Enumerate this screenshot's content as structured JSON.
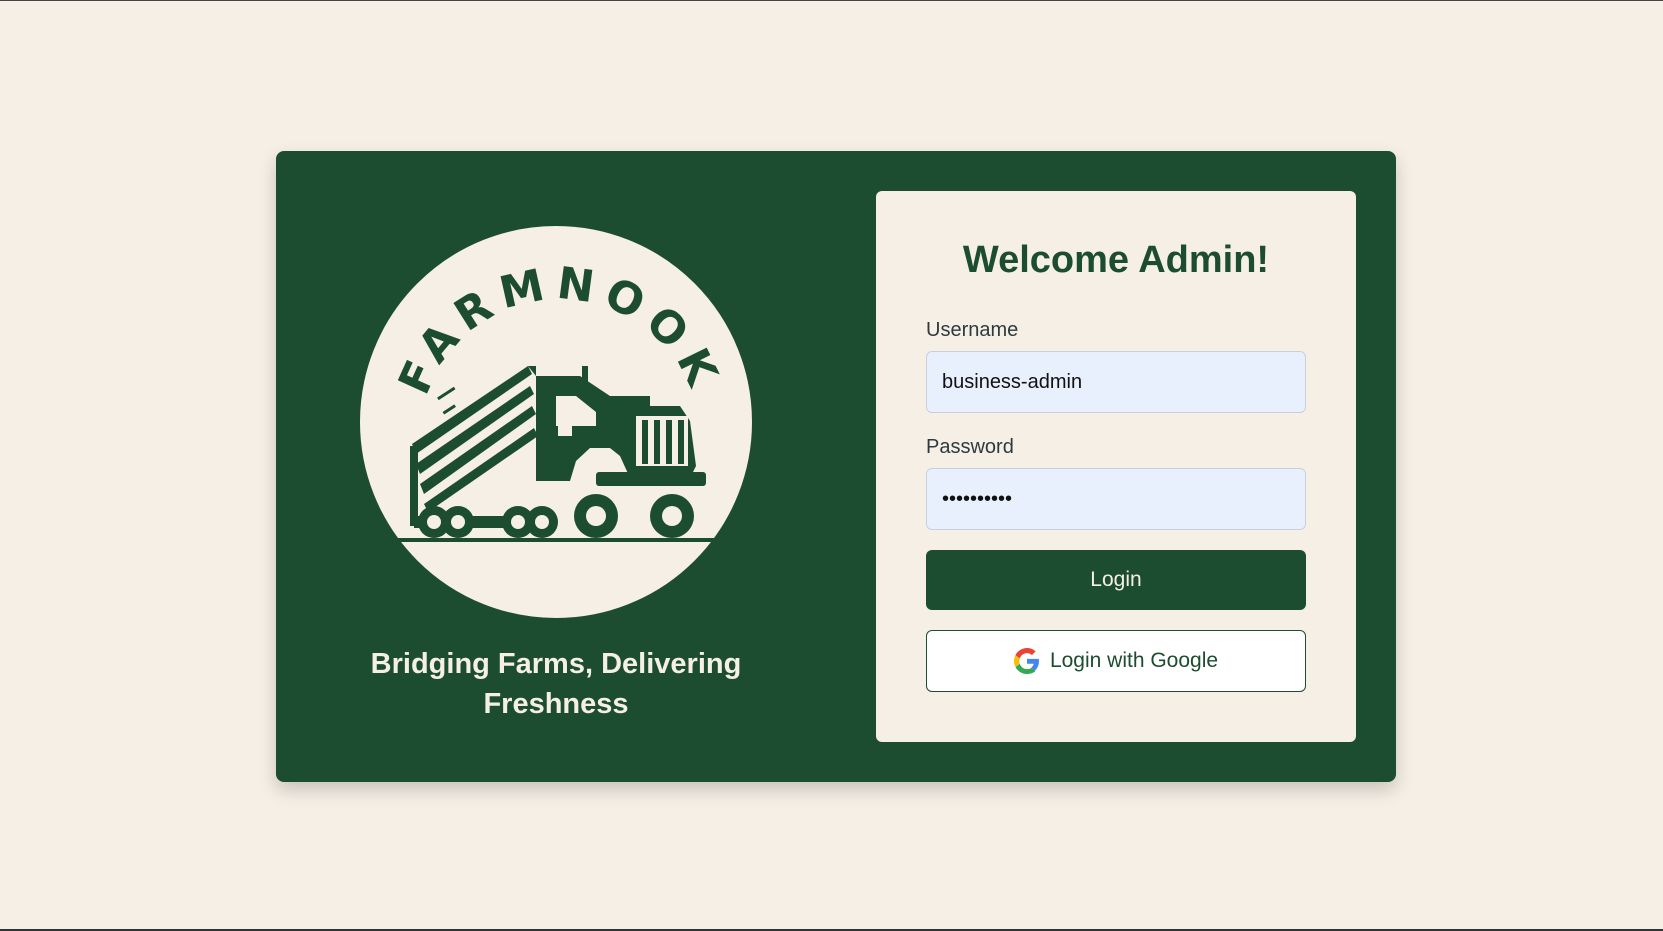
{
  "brand": {
    "logo_text": "FARMNOOK",
    "tagline": "Bridging Farms, Delivering Freshness"
  },
  "login": {
    "title": "Welcome Admin!",
    "username_label": "Username",
    "username_value": "business-admin",
    "password_label": "Password",
    "password_value": "••••••••••",
    "login_label": "Login",
    "google_label": "Login with Google"
  },
  "colors": {
    "page_background": "#f5efe5",
    "brand_green": "#1d4d30",
    "input_background": "#e8f0fe"
  },
  "icons": [
    "truck-logo-icon",
    "google-icon"
  ]
}
